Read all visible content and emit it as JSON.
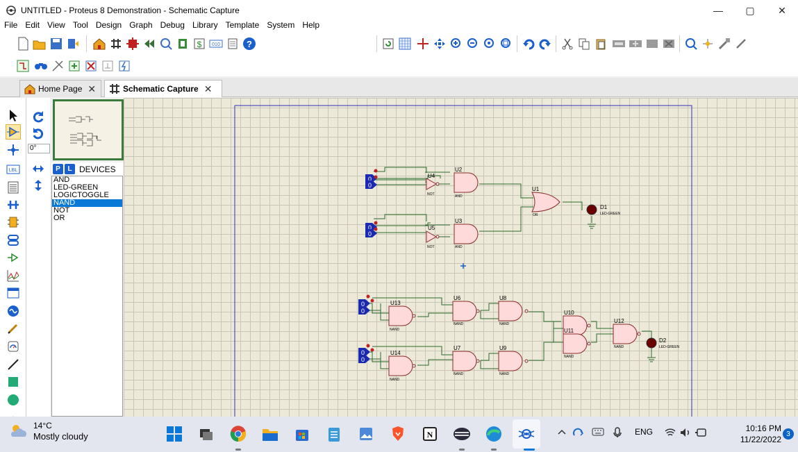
{
  "window": {
    "title": "UNTITLED - Proteus 8 Demonstration - Schematic Capture",
    "minimize": "—",
    "maximize": "▢",
    "close": "✕"
  },
  "menu": [
    "File",
    "Edit",
    "View",
    "Tool",
    "Design",
    "Graph",
    "Debug",
    "Library",
    "Template",
    "System",
    "Help"
  ],
  "tabs": [
    {
      "label": "Home Page",
      "close": "✕"
    },
    {
      "label": "Schematic Capture",
      "close": "✕"
    }
  ],
  "rotation": "0°",
  "devices": {
    "p_label": "P",
    "l_label": "L",
    "title": "DEVICES",
    "items": [
      "AND",
      "LED-GREEN",
      "LOGICTOGGLE",
      "NAND",
      "NOT",
      "OR"
    ],
    "selected": "NAND"
  },
  "schematic": {
    "circuit1": {
      "toggles": [
        "0",
        "0",
        "0",
        "0"
      ],
      "parts": {
        "u4": "U4",
        "u4_type": "NOT",
        "u5": "U5",
        "u5_type": "NOT",
        "u2": "U2",
        "u2_type": "AND",
        "u3": "U3",
        "u3_type": "AND",
        "u1": "U1",
        "u1_type": "OR",
        "d1": "D1",
        "d1_type": "LED-GREEN"
      }
    },
    "circuit2": {
      "toggles": [
        "0",
        "0",
        "0",
        "0"
      ],
      "parts": {
        "u13": "U13",
        "u13_type": "NAND",
        "u14": "U14",
        "u14_type": "NAND",
        "u6": "U6",
        "u6_type": "NAND",
        "u7": "U7",
        "u7_type": "NAND",
        "u8": "U8",
        "u8_type": "NAND",
        "u9": "U9",
        "u9_type": "NAND",
        "u10": "U10",
        "u11": "U11",
        "u11_type": "NAND",
        "u12": "U12",
        "u12_type": "NAND",
        "d2": "D2",
        "d2_type": "LED-GREEN"
      }
    }
  },
  "taskbar": {
    "temperature": "14°C",
    "condition": "Mostly cloudy",
    "language": "ENG",
    "time": "10:16 PM",
    "date": "11/22/2022",
    "notifications": "3"
  },
  "colors": {
    "wire": "#2d6b2d",
    "gate_fill": "#ffdada",
    "gate_stroke": "#8a2a2a",
    "toggle": "#1a2ab0",
    "sheet_border": "#3030c0",
    "led": "#6a0000"
  }
}
